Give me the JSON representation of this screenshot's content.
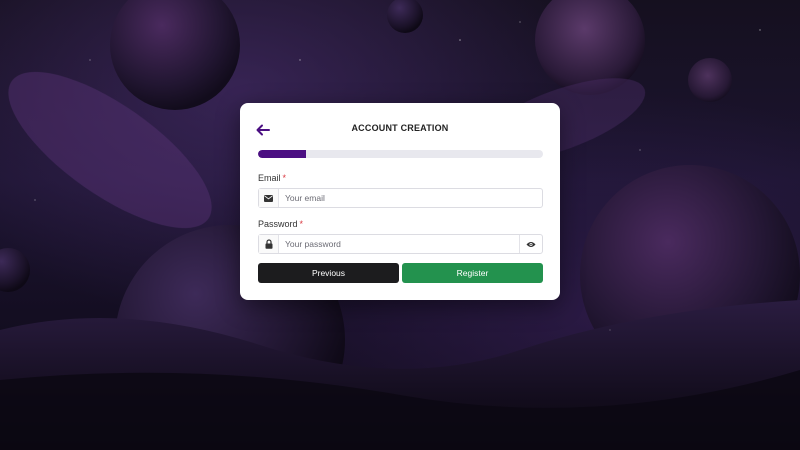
{
  "form": {
    "title": "ACCOUNT CREATION",
    "back_icon": "arrow-left-icon",
    "progress_percent": 17,
    "accent_color": "#4b0f82",
    "email": {
      "label": "Email",
      "required_mark": "*",
      "placeholder": "Your email",
      "value": "",
      "icon": "envelope-icon"
    },
    "password": {
      "label": "Password",
      "required_mark": "*",
      "placeholder": "Your password",
      "value": "",
      "icon": "lock-icon",
      "toggle_icon": "eye-icon"
    },
    "buttons": {
      "previous_label": "Previous",
      "previous_color": "#1c1c1e",
      "register_label": "Register",
      "register_color": "#23924e"
    }
  }
}
